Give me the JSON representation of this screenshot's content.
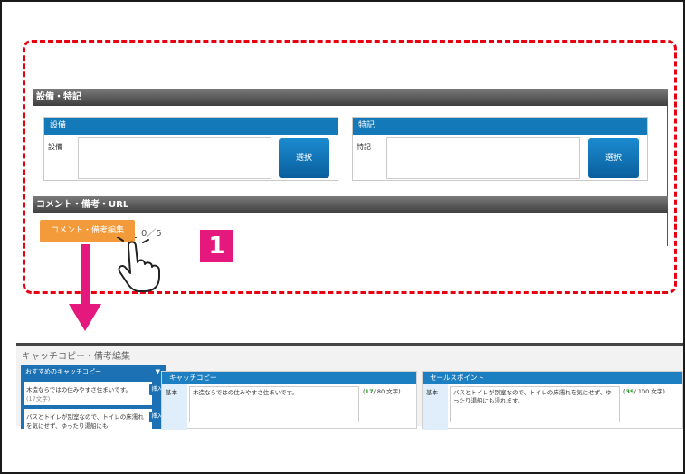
{
  "equipment_section": {
    "title": "設備・特記",
    "equipment": {
      "header": "設備",
      "row_label": "設備",
      "button": "選択"
    },
    "notes": {
      "header": "特記",
      "row_label": "特記",
      "button": "選択"
    }
  },
  "comment_section": {
    "title": "コメント・備考・URL",
    "edit_button": "コメント・備考編集",
    "count": "0／5"
  },
  "step_badge": "1",
  "editor": {
    "title": "キャッチコピー・備考編集",
    "recommend_header": "おすすめのキャッチコピー",
    "recommend_toggle": "▼",
    "recommend_items": [
      {
        "text": "木造ならではの住みやすさ住まいです。",
        "sub": "(17文字)",
        "button": "挿入"
      },
      {
        "text": "バスとトイレが別室なので、トイレの床濡れを気にせず、ゆったり湯船にも",
        "sub": "",
        "button": "挿入"
      }
    ],
    "catch_copy": {
      "header": "キャッチコピー",
      "label": "基本",
      "text": "木造ならではの住みやすさ住まいです。",
      "count_open": "(",
      "count_num": "17",
      "count_rest": "/ 80 文字)"
    },
    "sales_point": {
      "header": "セールスポイント",
      "label": "基本",
      "text": "バスとトイレが別室なので、トイレの床濡れを気にせず、ゆったり湯船にも浸れます。",
      "count_open": "(",
      "count_num": "39",
      "count_rest": "/ 100 文字)"
    }
  },
  "colors": {
    "accent_red": "#e60012",
    "accent_pink": "#e5197d",
    "blue": "#1479b8",
    "orange": "#f39a3a"
  }
}
